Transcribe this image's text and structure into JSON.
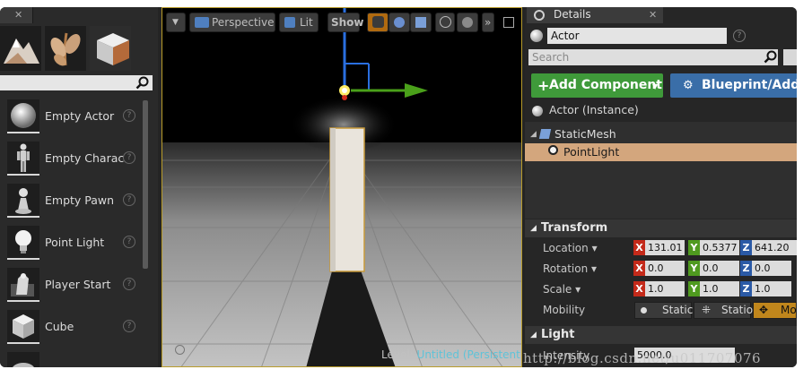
{
  "place_panel": {
    "items": [
      {
        "label": "Empty Actor",
        "icon": "sphere-icon"
      },
      {
        "label": "Empty Charac",
        "icon": "character-icon"
      },
      {
        "label": "Empty Pawn",
        "icon": "pawn-icon"
      },
      {
        "label": "Point Light",
        "icon": "lightbulb-icon"
      },
      {
        "label": "Player Start",
        "icon": "player-start-icon"
      },
      {
        "label": "Cube",
        "icon": "cube-icon"
      }
    ],
    "help_glyph": "?"
  },
  "viewport": {
    "perspective_label": "Perspective",
    "lit_label": "Lit",
    "show_label": "Show",
    "more_label": "»",
    "level_label": "Level:",
    "level_name": "Untitled (Persistent)"
  },
  "details": {
    "tab_label": "Details",
    "actor_name": "Actor",
    "search_placeholder": "Search",
    "add_component_label": "Add Component",
    "blueprint_label": "Blueprint/Add S",
    "instance_label": "Actor (Instance)",
    "components": [
      {
        "label": "StaticMesh",
        "selected": false
      },
      {
        "label": "PointLight",
        "selected": true
      }
    ],
    "transform": {
      "title": "Transform",
      "location_label": "Location",
      "rotation_label": "Rotation",
      "scale_label": "Scale",
      "mobility_label": "Mobility",
      "location": {
        "x": "131.01",
        "y": "0.5377",
        "z": "641.20"
      },
      "rotation": {
        "x": "0.0",
        "y": "0.0",
        "z": "0.0"
      },
      "scale": {
        "x": "1.0",
        "y": "1.0",
        "z": "1.0"
      },
      "mobility_options": [
        "Static",
        "Statio",
        "Mo"
      ],
      "mobility_selected": "Mo"
    },
    "light": {
      "title": "Light",
      "intensity_label": "Intensity",
      "intensity_value": "5000.0"
    }
  },
  "watermark": "http://blog.csdn.net/u011707076",
  "colors": {
    "accent_green": "#3f9a3a",
    "accent_blue": "#3a6ea8",
    "selection": "#d3a67d",
    "axis_x": "#c42a1a",
    "axis_y": "#4f9a1f",
    "axis_z": "#2b5aa6",
    "level_name": "#5fc3d8"
  }
}
